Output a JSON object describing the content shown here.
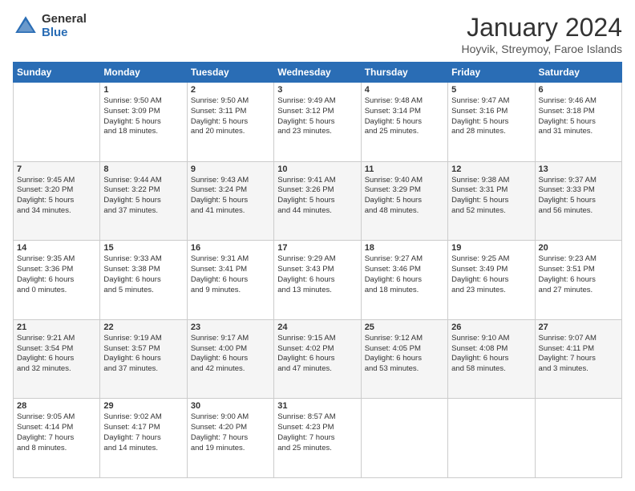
{
  "header": {
    "logo_general": "General",
    "logo_blue": "Blue",
    "month_title": "January 2024",
    "subtitle": "Hoyvik, Streymoy, Faroe Islands"
  },
  "days_of_week": [
    "Sunday",
    "Monday",
    "Tuesday",
    "Wednesday",
    "Thursday",
    "Friday",
    "Saturday"
  ],
  "weeks": [
    [
      {
        "day": "",
        "info": ""
      },
      {
        "day": "1",
        "info": "Sunrise: 9:50 AM\nSunset: 3:09 PM\nDaylight: 5 hours\nand 18 minutes."
      },
      {
        "day": "2",
        "info": "Sunrise: 9:50 AM\nSunset: 3:11 PM\nDaylight: 5 hours\nand 20 minutes."
      },
      {
        "day": "3",
        "info": "Sunrise: 9:49 AM\nSunset: 3:12 PM\nDaylight: 5 hours\nand 23 minutes."
      },
      {
        "day": "4",
        "info": "Sunrise: 9:48 AM\nSunset: 3:14 PM\nDaylight: 5 hours\nand 25 minutes."
      },
      {
        "day": "5",
        "info": "Sunrise: 9:47 AM\nSunset: 3:16 PM\nDaylight: 5 hours\nand 28 minutes."
      },
      {
        "day": "6",
        "info": "Sunrise: 9:46 AM\nSunset: 3:18 PM\nDaylight: 5 hours\nand 31 minutes."
      }
    ],
    [
      {
        "day": "7",
        "info": "Sunrise: 9:45 AM\nSunset: 3:20 PM\nDaylight: 5 hours\nand 34 minutes."
      },
      {
        "day": "8",
        "info": "Sunrise: 9:44 AM\nSunset: 3:22 PM\nDaylight: 5 hours\nand 37 minutes."
      },
      {
        "day": "9",
        "info": "Sunrise: 9:43 AM\nSunset: 3:24 PM\nDaylight: 5 hours\nand 41 minutes."
      },
      {
        "day": "10",
        "info": "Sunrise: 9:41 AM\nSunset: 3:26 PM\nDaylight: 5 hours\nand 44 minutes."
      },
      {
        "day": "11",
        "info": "Sunrise: 9:40 AM\nSunset: 3:29 PM\nDaylight: 5 hours\nand 48 minutes."
      },
      {
        "day": "12",
        "info": "Sunrise: 9:38 AM\nSunset: 3:31 PM\nDaylight: 5 hours\nand 52 minutes."
      },
      {
        "day": "13",
        "info": "Sunrise: 9:37 AM\nSunset: 3:33 PM\nDaylight: 5 hours\nand 56 minutes."
      }
    ],
    [
      {
        "day": "14",
        "info": "Sunrise: 9:35 AM\nSunset: 3:36 PM\nDaylight: 6 hours\nand 0 minutes."
      },
      {
        "day": "15",
        "info": "Sunrise: 9:33 AM\nSunset: 3:38 PM\nDaylight: 6 hours\nand 5 minutes."
      },
      {
        "day": "16",
        "info": "Sunrise: 9:31 AM\nSunset: 3:41 PM\nDaylight: 6 hours\nand 9 minutes."
      },
      {
        "day": "17",
        "info": "Sunrise: 9:29 AM\nSunset: 3:43 PM\nDaylight: 6 hours\nand 13 minutes."
      },
      {
        "day": "18",
        "info": "Sunrise: 9:27 AM\nSunset: 3:46 PM\nDaylight: 6 hours\nand 18 minutes."
      },
      {
        "day": "19",
        "info": "Sunrise: 9:25 AM\nSunset: 3:49 PM\nDaylight: 6 hours\nand 23 minutes."
      },
      {
        "day": "20",
        "info": "Sunrise: 9:23 AM\nSunset: 3:51 PM\nDaylight: 6 hours\nand 27 minutes."
      }
    ],
    [
      {
        "day": "21",
        "info": "Sunrise: 9:21 AM\nSunset: 3:54 PM\nDaylight: 6 hours\nand 32 minutes."
      },
      {
        "day": "22",
        "info": "Sunrise: 9:19 AM\nSunset: 3:57 PM\nDaylight: 6 hours\nand 37 minutes."
      },
      {
        "day": "23",
        "info": "Sunrise: 9:17 AM\nSunset: 4:00 PM\nDaylight: 6 hours\nand 42 minutes."
      },
      {
        "day": "24",
        "info": "Sunrise: 9:15 AM\nSunset: 4:02 PM\nDaylight: 6 hours\nand 47 minutes."
      },
      {
        "day": "25",
        "info": "Sunrise: 9:12 AM\nSunset: 4:05 PM\nDaylight: 6 hours\nand 53 minutes."
      },
      {
        "day": "26",
        "info": "Sunrise: 9:10 AM\nSunset: 4:08 PM\nDaylight: 6 hours\nand 58 minutes."
      },
      {
        "day": "27",
        "info": "Sunrise: 9:07 AM\nSunset: 4:11 PM\nDaylight: 7 hours\nand 3 minutes."
      }
    ],
    [
      {
        "day": "28",
        "info": "Sunrise: 9:05 AM\nSunset: 4:14 PM\nDaylight: 7 hours\nand 8 minutes."
      },
      {
        "day": "29",
        "info": "Sunrise: 9:02 AM\nSunset: 4:17 PM\nDaylight: 7 hours\nand 14 minutes."
      },
      {
        "day": "30",
        "info": "Sunrise: 9:00 AM\nSunset: 4:20 PM\nDaylight: 7 hours\nand 19 minutes."
      },
      {
        "day": "31",
        "info": "Sunrise: 8:57 AM\nSunset: 4:23 PM\nDaylight: 7 hours\nand 25 minutes."
      },
      {
        "day": "",
        "info": ""
      },
      {
        "day": "",
        "info": ""
      },
      {
        "day": "",
        "info": ""
      }
    ]
  ]
}
